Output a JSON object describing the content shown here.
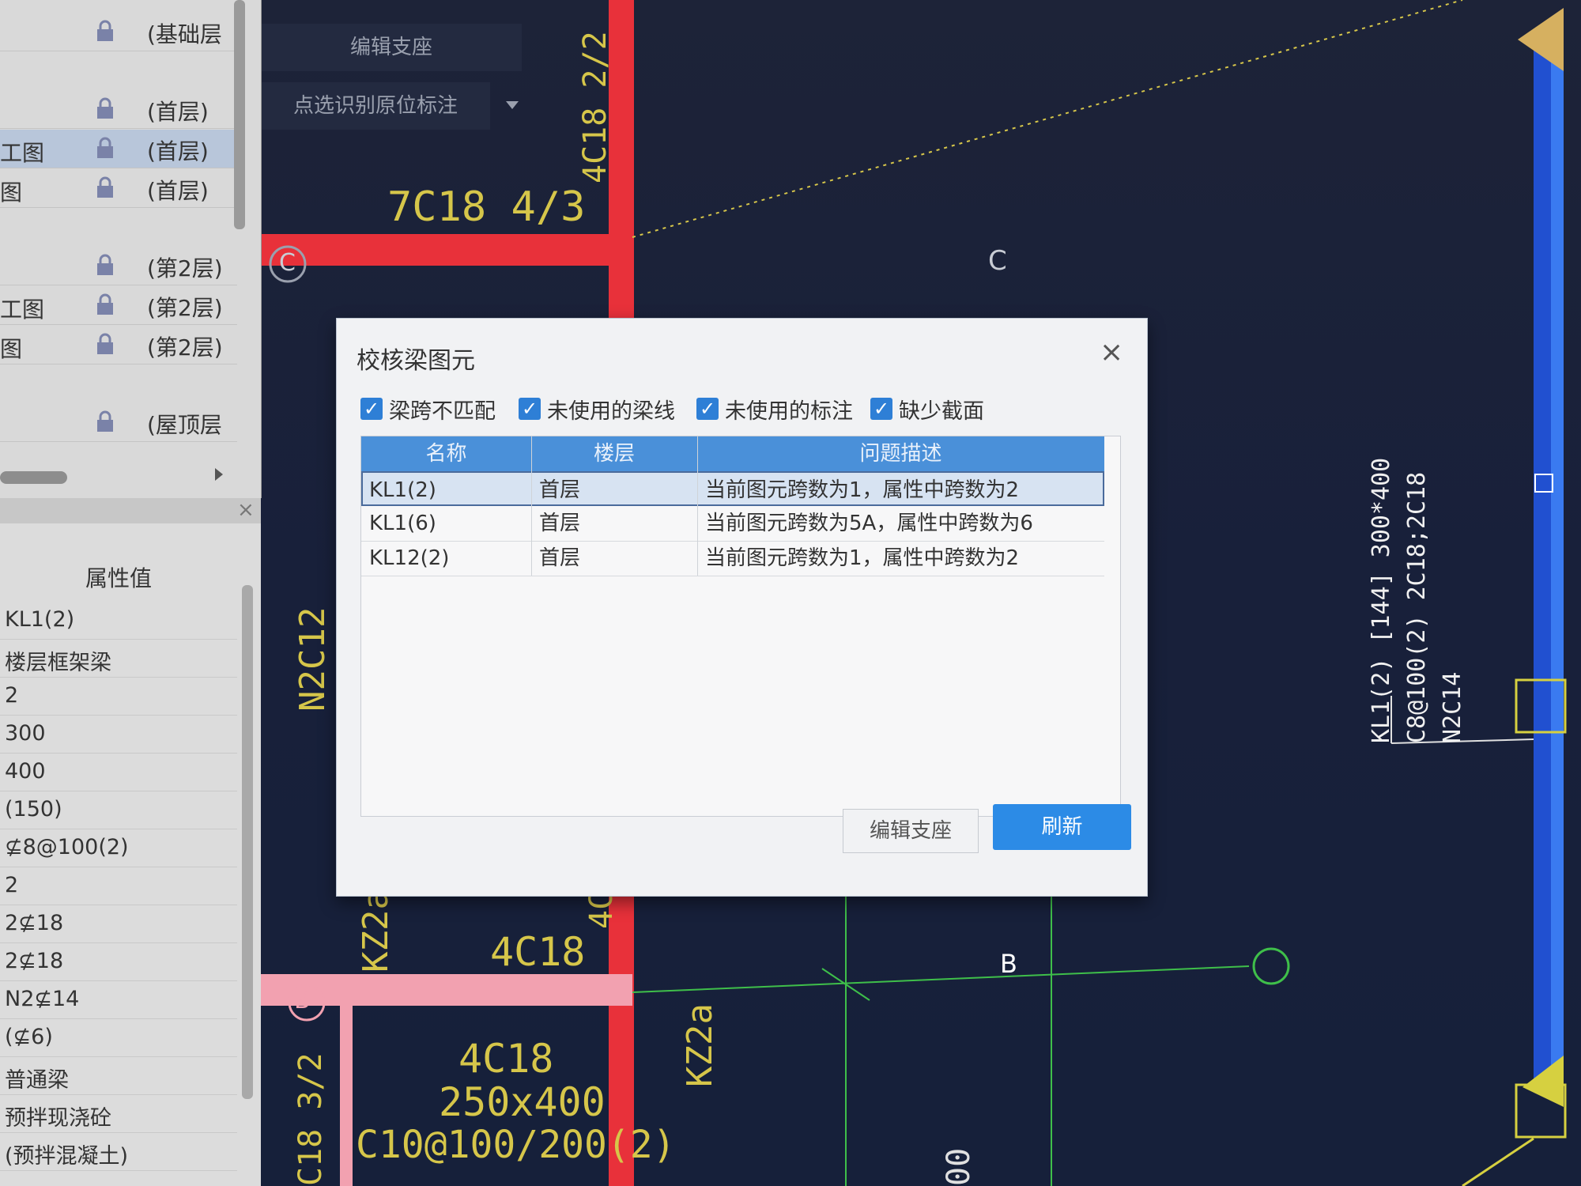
{
  "layer_panel": {
    "rows": [
      {
        "name": "",
        "floor": "(基础层"
      },
      {
        "name": "",
        "floor": "(首层)"
      },
      {
        "name": "工图",
        "floor": "(首层)",
        "selected": true
      },
      {
        "name": "图",
        "floor": "(首层)"
      },
      {
        "name": "",
        "floor": "(第2层)"
      },
      {
        "name": "工图",
        "floor": "(第2层)"
      },
      {
        "name": "图",
        "floor": "(第2层)"
      },
      {
        "name": "",
        "floor": "(屋顶层"
      }
    ]
  },
  "property_panel": {
    "header": "属性值",
    "values": [
      "KL1(2)",
      "楼层框架梁",
      "2",
      "300",
      "400",
      "(150)",
      "⊈8@100(2)",
      "2",
      "2⊈18",
      "2⊈18",
      "N2⊈14",
      "(⊈6)",
      "普通梁",
      "预拌现浇砼",
      "(预拌混凝土)"
    ]
  },
  "toolbar": {
    "edit_support": "编辑支座",
    "point_select": "点选识别原位标注"
  },
  "dialog": {
    "title": "校核梁图元",
    "close_icon": "×",
    "checkboxes": [
      {
        "label": "梁跨不匹配",
        "checked": true
      },
      {
        "label": "未使用的梁线",
        "checked": true
      },
      {
        "label": "未使用的标注",
        "checked": true
      },
      {
        "label": "缺少截面",
        "checked": true
      }
    ],
    "columns": [
      "名称",
      "楼层",
      "问题描述"
    ],
    "rows": [
      {
        "name": "KL1(2)",
        "floor": "首层",
        "desc": "当前图元跨数为1，属性中跨数为2"
      },
      {
        "name": "KL1(6)",
        "floor": "首层",
        "desc": "当前图元跨数为5A，属性中跨数为6"
      },
      {
        "name": "KL12(2)",
        "floor": "首层",
        "desc": "当前图元跨数为1，属性中跨数为2"
      }
    ],
    "buttons": {
      "edit": "编辑支座",
      "refresh": "刷新"
    }
  },
  "cad": {
    "labels": {
      "top_rebar": "7C18 4/3",
      "top_side": "4C18 2/2",
      "axis_c": "C",
      "axis_b": "B",
      "left_n": "N2C12",
      "bottom_4c18": "4C18",
      "bottom_4c": "4C",
      "kz2a_1": "KZ2a",
      "kz2a_2": "KZ2a",
      "bot_box_1": "4C18",
      "bot_box_2": "250x400",
      "bot_box_3": "C10@100/200(2)",
      "bottom_left_v": "C18 3/2",
      "bottom_00": "00",
      "beam_line1": "KL1(2) [144] 300*400",
      "beam_line2": "C8@100(2) 2C18;2C18",
      "beam_line3": "N2C14"
    },
    "colors": {
      "background": "#1b2236",
      "beam_red": "#e8313a",
      "rebar_yellow": "#d6c64a",
      "axis_green": "#3fbf4a",
      "selected_pink": "#f2a1b0"
    }
  }
}
